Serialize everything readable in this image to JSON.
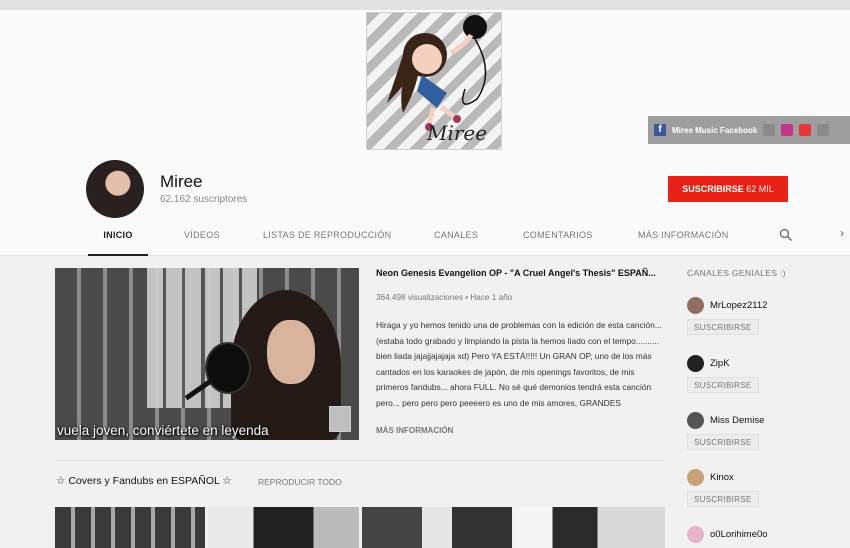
{
  "banner": {
    "signature": "Miree",
    "links_text": "Miree Music Facebook",
    "social_icon_colors": [
      "#8a8a8a",
      "#c13584",
      "#e53935",
      "#8a8a8a"
    ]
  },
  "channel": {
    "name": "Miree",
    "subscribers": "62.162 suscriptores",
    "subscribe_label": "SUSCRIBIRSE",
    "subscribe_count": "62 MIL"
  },
  "tabs": [
    {
      "label": "INICIO",
      "active": true
    },
    {
      "label": "VÍDEOS"
    },
    {
      "label": "LISTAS DE REPRODUCCIÓN"
    },
    {
      "label": "CANALES"
    },
    {
      "label": "COMENTARIOS"
    },
    {
      "label": "MÁS INFORMACIÓN"
    }
  ],
  "featured": {
    "caption": "vuela joven, conviértete en leyenda",
    "title": "Neon Genesis Evangelion OP - \"A Cruel Angel's Thesis\" ESPAÑ...",
    "meta": "364.498 visualizaciones • Hace 1 año",
    "description": "Hiraga y yo hemos tenido una de problemas con la edición de esta canción... (estaba todo grabado y limpiando la pista la hemos liado con el tempo.......... bien liada jajajjajajaja xd) Pero YA ESTÁ!!!!! Un GRAN OP, uno de los más cantados en los karaokes de japón, de mis openings favoritos, de mis primeros fandubs... ahora FULL. No sé qué demonios tendrá esta canción pero... pero pero pero peeeero es uno de mis amores, GRANDES",
    "more_label": "MÁS INFORMACIÓN"
  },
  "shelf": {
    "title": "☆ Covers y Fandubs en ESPAÑOL ☆",
    "play_all": "REPRODUCIR TODO"
  },
  "sidebar": {
    "title": "CANALES GENIALES :)",
    "subscribe_label": "SUSCRIBIRSE",
    "items": [
      {
        "name": "MrLopez2112",
        "color": "#8d6e63"
      },
      {
        "name": "ZipK",
        "color": "#222222"
      },
      {
        "name": "Miss Demise",
        "color": "#555555"
      },
      {
        "name": "Kinox",
        "color": "#c9a27a"
      },
      {
        "name": "o0Lorihime0o",
        "color": "#e8b4c8"
      }
    ]
  },
  "colors": {
    "accent": "#e62117",
    "facebook": "#3b5998"
  }
}
